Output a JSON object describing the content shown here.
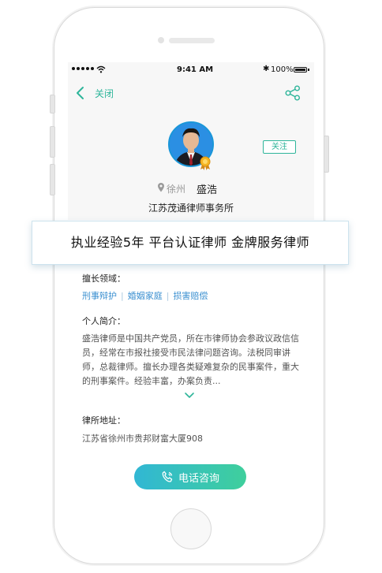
{
  "status_bar": {
    "time": "9:41 AM",
    "battery": "100%"
  },
  "nav": {
    "close_label": "关闭"
  },
  "profile": {
    "follow_label": "关注",
    "city": "徐州",
    "name": "盛浩",
    "firm": "江苏茂通律师事务所"
  },
  "banner": {
    "text": "执业经验5年  平台认证律师  金牌服务律师"
  },
  "specialties": {
    "label": "擅长领域：",
    "tags": [
      "刑事辩护",
      "婚姻家庭",
      "损害赔偿"
    ]
  },
  "bio": {
    "label": "个人简介：",
    "text": "盛浩律师是中国共产党员，所在市律师协会参政议政信信员，经常在市报社接受市民法律问题咨询。法税同审讲师，总裁律师。擅长办理各类疑难复杂的民事案件，重大的刑事案件。经验丰富，办案负责..."
  },
  "address": {
    "label": "律所地址：",
    "text": "江苏省徐州市贵邦财富大厦908"
  },
  "call_button": {
    "label": "电话咨询"
  },
  "colors": {
    "accent": "#2eb59a",
    "tag_blue": "#3a8fd0",
    "button_start": "#31b7d4",
    "button_end": "#3fcf9c"
  }
}
